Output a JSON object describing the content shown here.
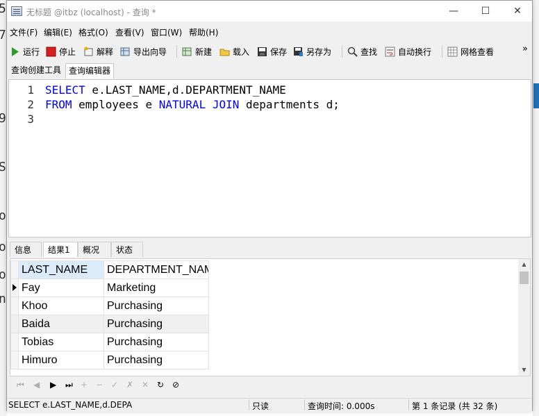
{
  "window": {
    "title": "无标题 @itbz (localhost) - 查询 *",
    "minimize": "—",
    "maximize": "☐",
    "close": "✕"
  },
  "menu": [
    "文件(F)",
    "编辑(E)",
    "格式(O)",
    "查看(V)",
    "窗口(W)",
    "帮助(H)"
  ],
  "toolbar": {
    "run": "运行",
    "stop": "停止",
    "explain": "解释",
    "export_wizard": "导出向导",
    "new": "新建",
    "load": "载入",
    "save": "保存",
    "save_as": "另存为",
    "find": "查找",
    "word_wrap": "自动换行",
    "grid_view": "网格查看",
    "more": "»"
  },
  "editor_tabs": [
    "查询创建工具",
    "查询编辑器"
  ],
  "editor": {
    "lines": [
      {
        "num": "1",
        "kw1": "SELECT",
        "rest1": " e.LAST_NAME,d.DEPARTMENT_NAME"
      },
      {
        "num": "2",
        "kw1": "FROM",
        "rest1": " employees e ",
        "kw2": "NATURAL JOIN",
        "rest2": " departments d;"
      },
      {
        "num": "3"
      }
    ]
  },
  "result_tabs": [
    "信息",
    "结果1",
    "概况",
    "状态"
  ],
  "grid": {
    "columns": [
      "LAST_NAME",
      "DEPARTMENT_NAME"
    ],
    "rows": [
      [
        "Fay",
        "Marketing"
      ],
      [
        "Khoo",
        "Purchasing"
      ],
      [
        "Baida",
        "Purchasing"
      ],
      [
        "Tobias",
        "Purchasing"
      ],
      [
        "Himuro",
        "Purchasing"
      ]
    ]
  },
  "nav_buttons": [
    "⏮",
    "◀",
    "▶",
    "⏭",
    "+",
    "−",
    "✓",
    "✗",
    "✕",
    "↻",
    "⊘"
  ],
  "status": {
    "sql": "SELECT e.LAST_NAME,d.DEPAR",
    "mode": "只读",
    "query_time": "查询时间: 0.000s",
    "record": "第 1 条记录 (共 32 条)"
  },
  "colors": {
    "keyword": "#0000ff",
    "selected_header": "#dcebfa"
  }
}
